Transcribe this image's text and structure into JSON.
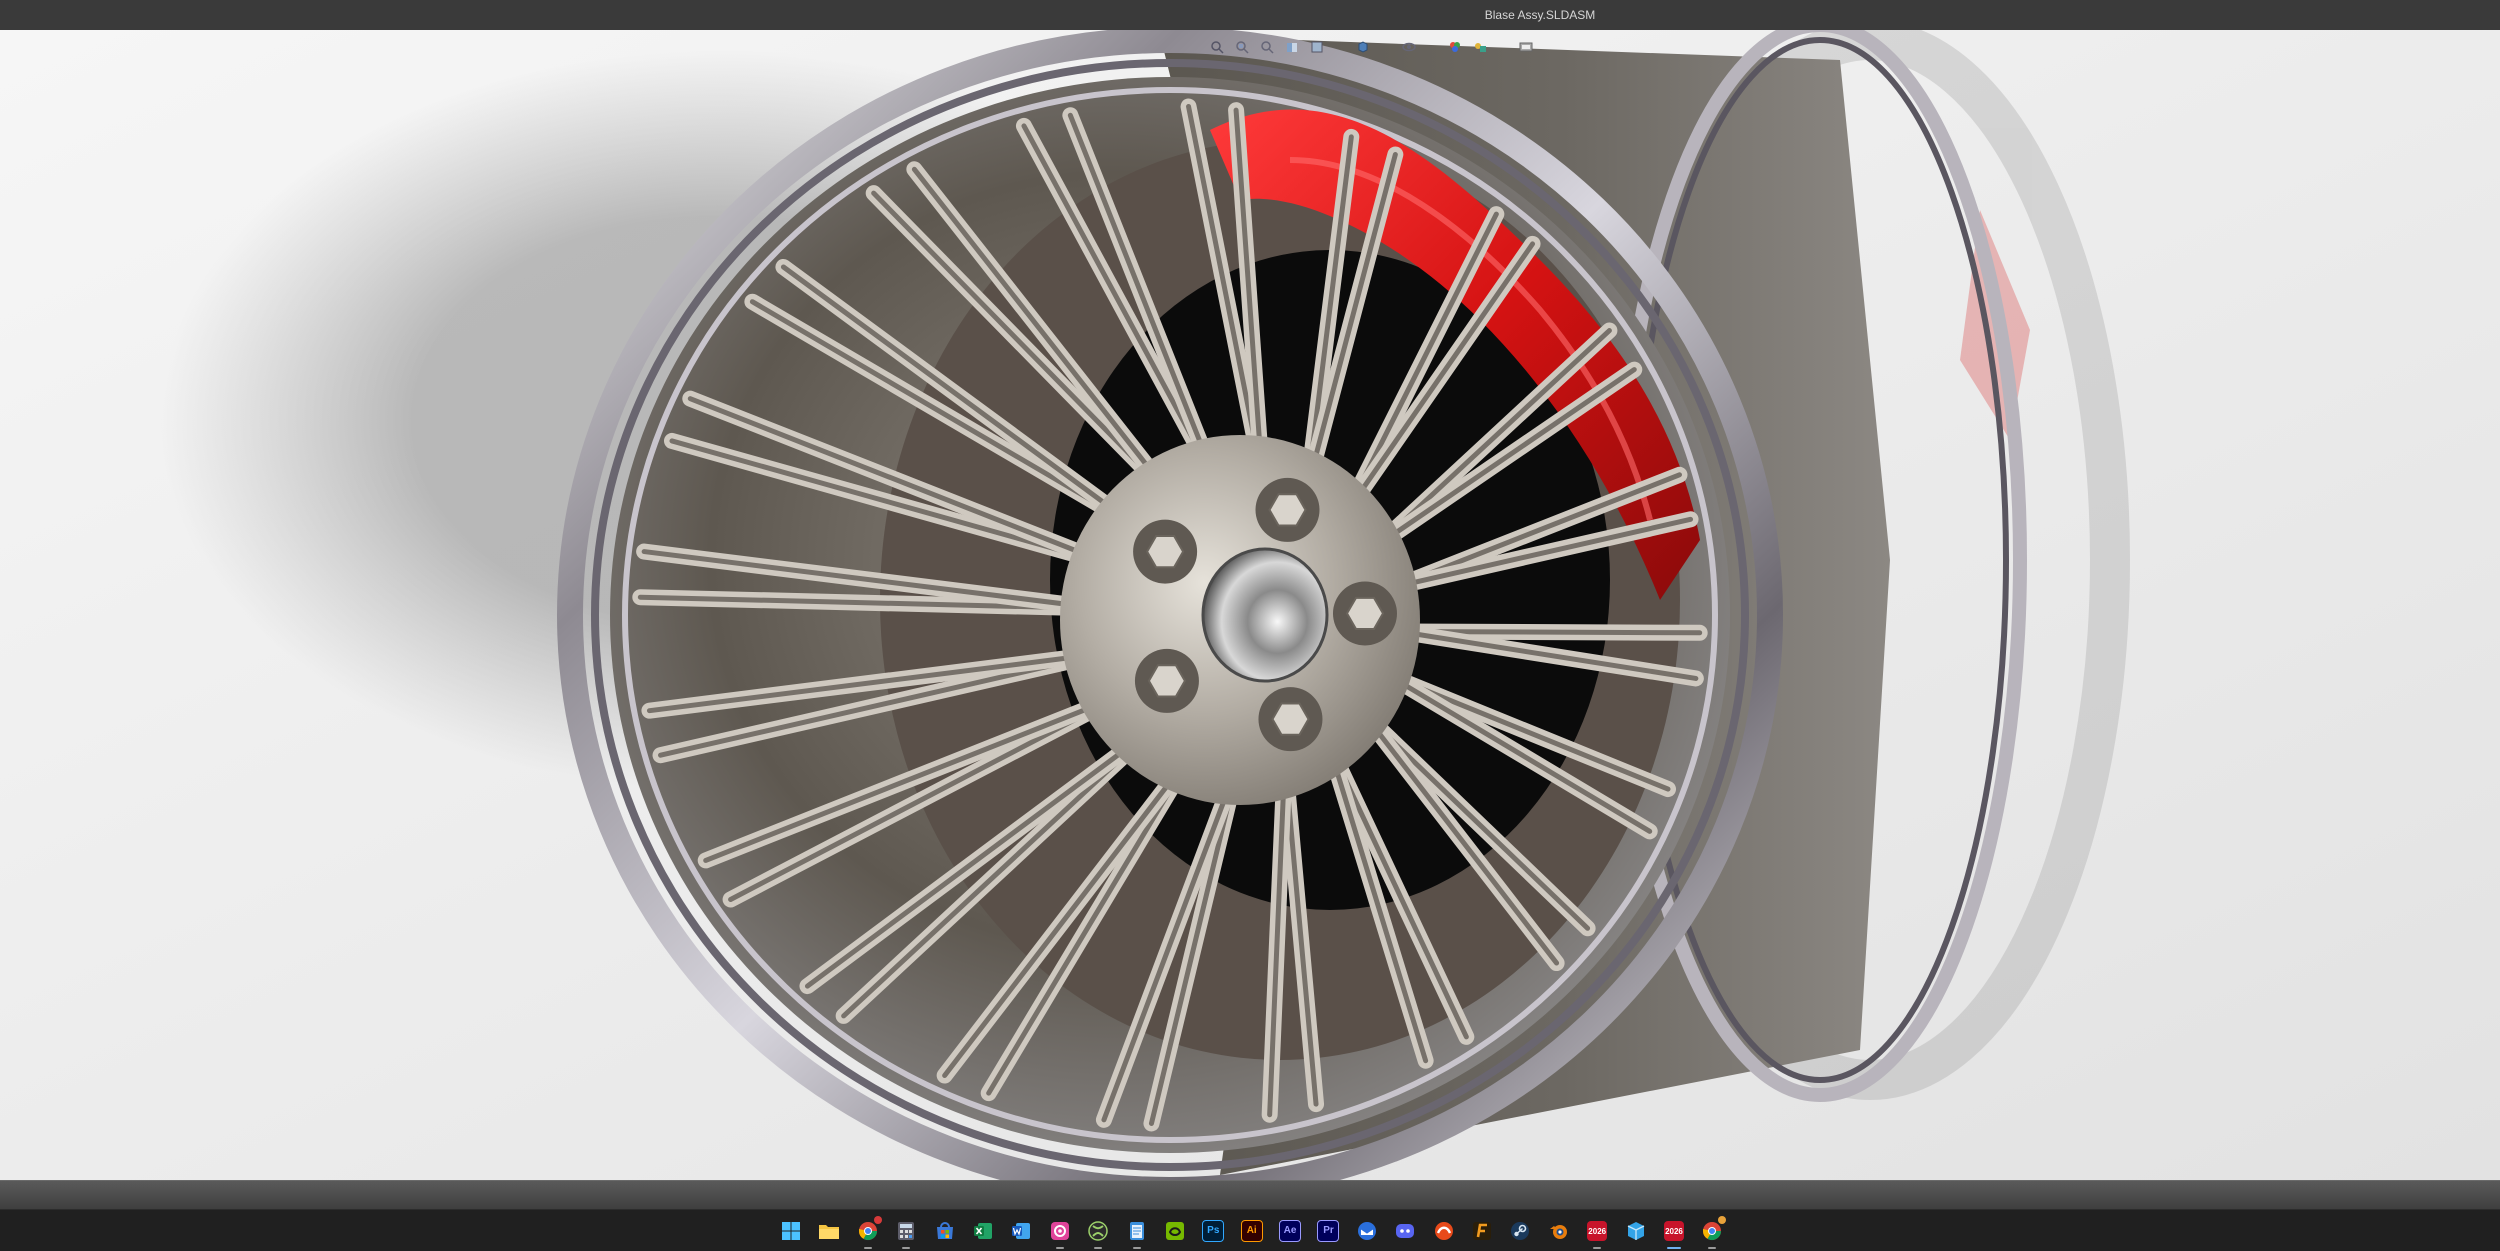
{
  "window": {
    "title": "Blase Assy.SLDASM",
    "background_color": "#efefef",
    "caliper_color": "#d41212"
  },
  "viewport_toolbar": {
    "items": [
      {
        "icon": "zoom-to-fit-icon"
      },
      {
        "icon": "zoom-to-area-icon"
      },
      {
        "icon": "previous-view-icon"
      },
      {
        "icon": "section-view-icon"
      },
      {
        "icon": "view-orientation-icon"
      },
      {
        "icon": "display-style-icon"
      },
      {
        "icon": "hide-show-items-icon"
      },
      {
        "icon": "edit-appearance-icon"
      },
      {
        "icon": "apply-scene-icon"
      },
      {
        "icon": "view-settings-icon"
      }
    ]
  },
  "taskbar": {
    "apps": [
      {
        "icon": "windows-start-icon",
        "label": ""
      },
      {
        "icon": "file-explorer-icon",
        "label": ""
      },
      {
        "icon": "chrome-icon",
        "label": ""
      },
      {
        "icon": "calculator-icon",
        "label": ""
      },
      {
        "icon": "microsoft-store-icon",
        "label": ""
      },
      {
        "icon": "excel-icon",
        "label": ""
      },
      {
        "icon": "word-icon",
        "label": ""
      },
      {
        "icon": "snipping-tool-icon",
        "label": ""
      },
      {
        "icon": "xbox-icon",
        "label": ""
      },
      {
        "icon": "notepad-icon",
        "label": ""
      },
      {
        "icon": "nvidia-icon",
        "label": ""
      },
      {
        "icon": "photoshop-icon",
        "label": "Ps"
      },
      {
        "icon": "illustrator-icon",
        "label": "Ai"
      },
      {
        "icon": "after-effects-icon",
        "label": "Ae"
      },
      {
        "icon": "premiere-pro-icon",
        "label": "Pr"
      },
      {
        "icon": "thunderbird-icon",
        "label": ""
      },
      {
        "icon": "discord-icon",
        "label": ""
      },
      {
        "icon": "epic-games-icon",
        "label": ""
      },
      {
        "icon": "fusion-icon",
        "label": ""
      },
      {
        "icon": "steam-icon",
        "label": ""
      },
      {
        "icon": "blender-icon",
        "label": ""
      },
      {
        "icon": "solidworks-2026-icon",
        "label": "2026"
      },
      {
        "icon": "box-icon",
        "label": ""
      },
      {
        "icon": "solidworks-2026-active-icon",
        "label": "2026"
      },
      {
        "icon": "chrome-profile-icon",
        "label": ""
      }
    ]
  }
}
